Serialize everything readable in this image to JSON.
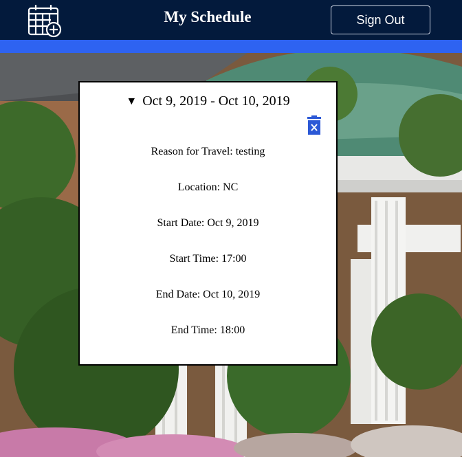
{
  "header": {
    "title": "My Schedule",
    "sign_out_label": "Sign Out",
    "add_icon": "calendar-add-icon"
  },
  "colors": {
    "nav_bg": "#031a3c",
    "accent_bar": "#2e63f1",
    "trash_icon": "#2b58d6"
  },
  "trip": {
    "summary": "Oct 9, 2019 - Oct 10, 2019",
    "expanded_marker": "▼",
    "delete_icon": "trash-icon",
    "fields": [
      {
        "label": "Reason for Travel:",
        "value": "testing"
      },
      {
        "label": "Location:",
        "value": "NC"
      },
      {
        "label": "Start Date:",
        "value": "Oct 9, 2019"
      },
      {
        "label": "Start Time:",
        "value": "17:00"
      },
      {
        "label": "End Date:",
        "value": "Oct 10, 2019"
      },
      {
        "label": "End Time:",
        "value": "18:00"
      }
    ]
  }
}
